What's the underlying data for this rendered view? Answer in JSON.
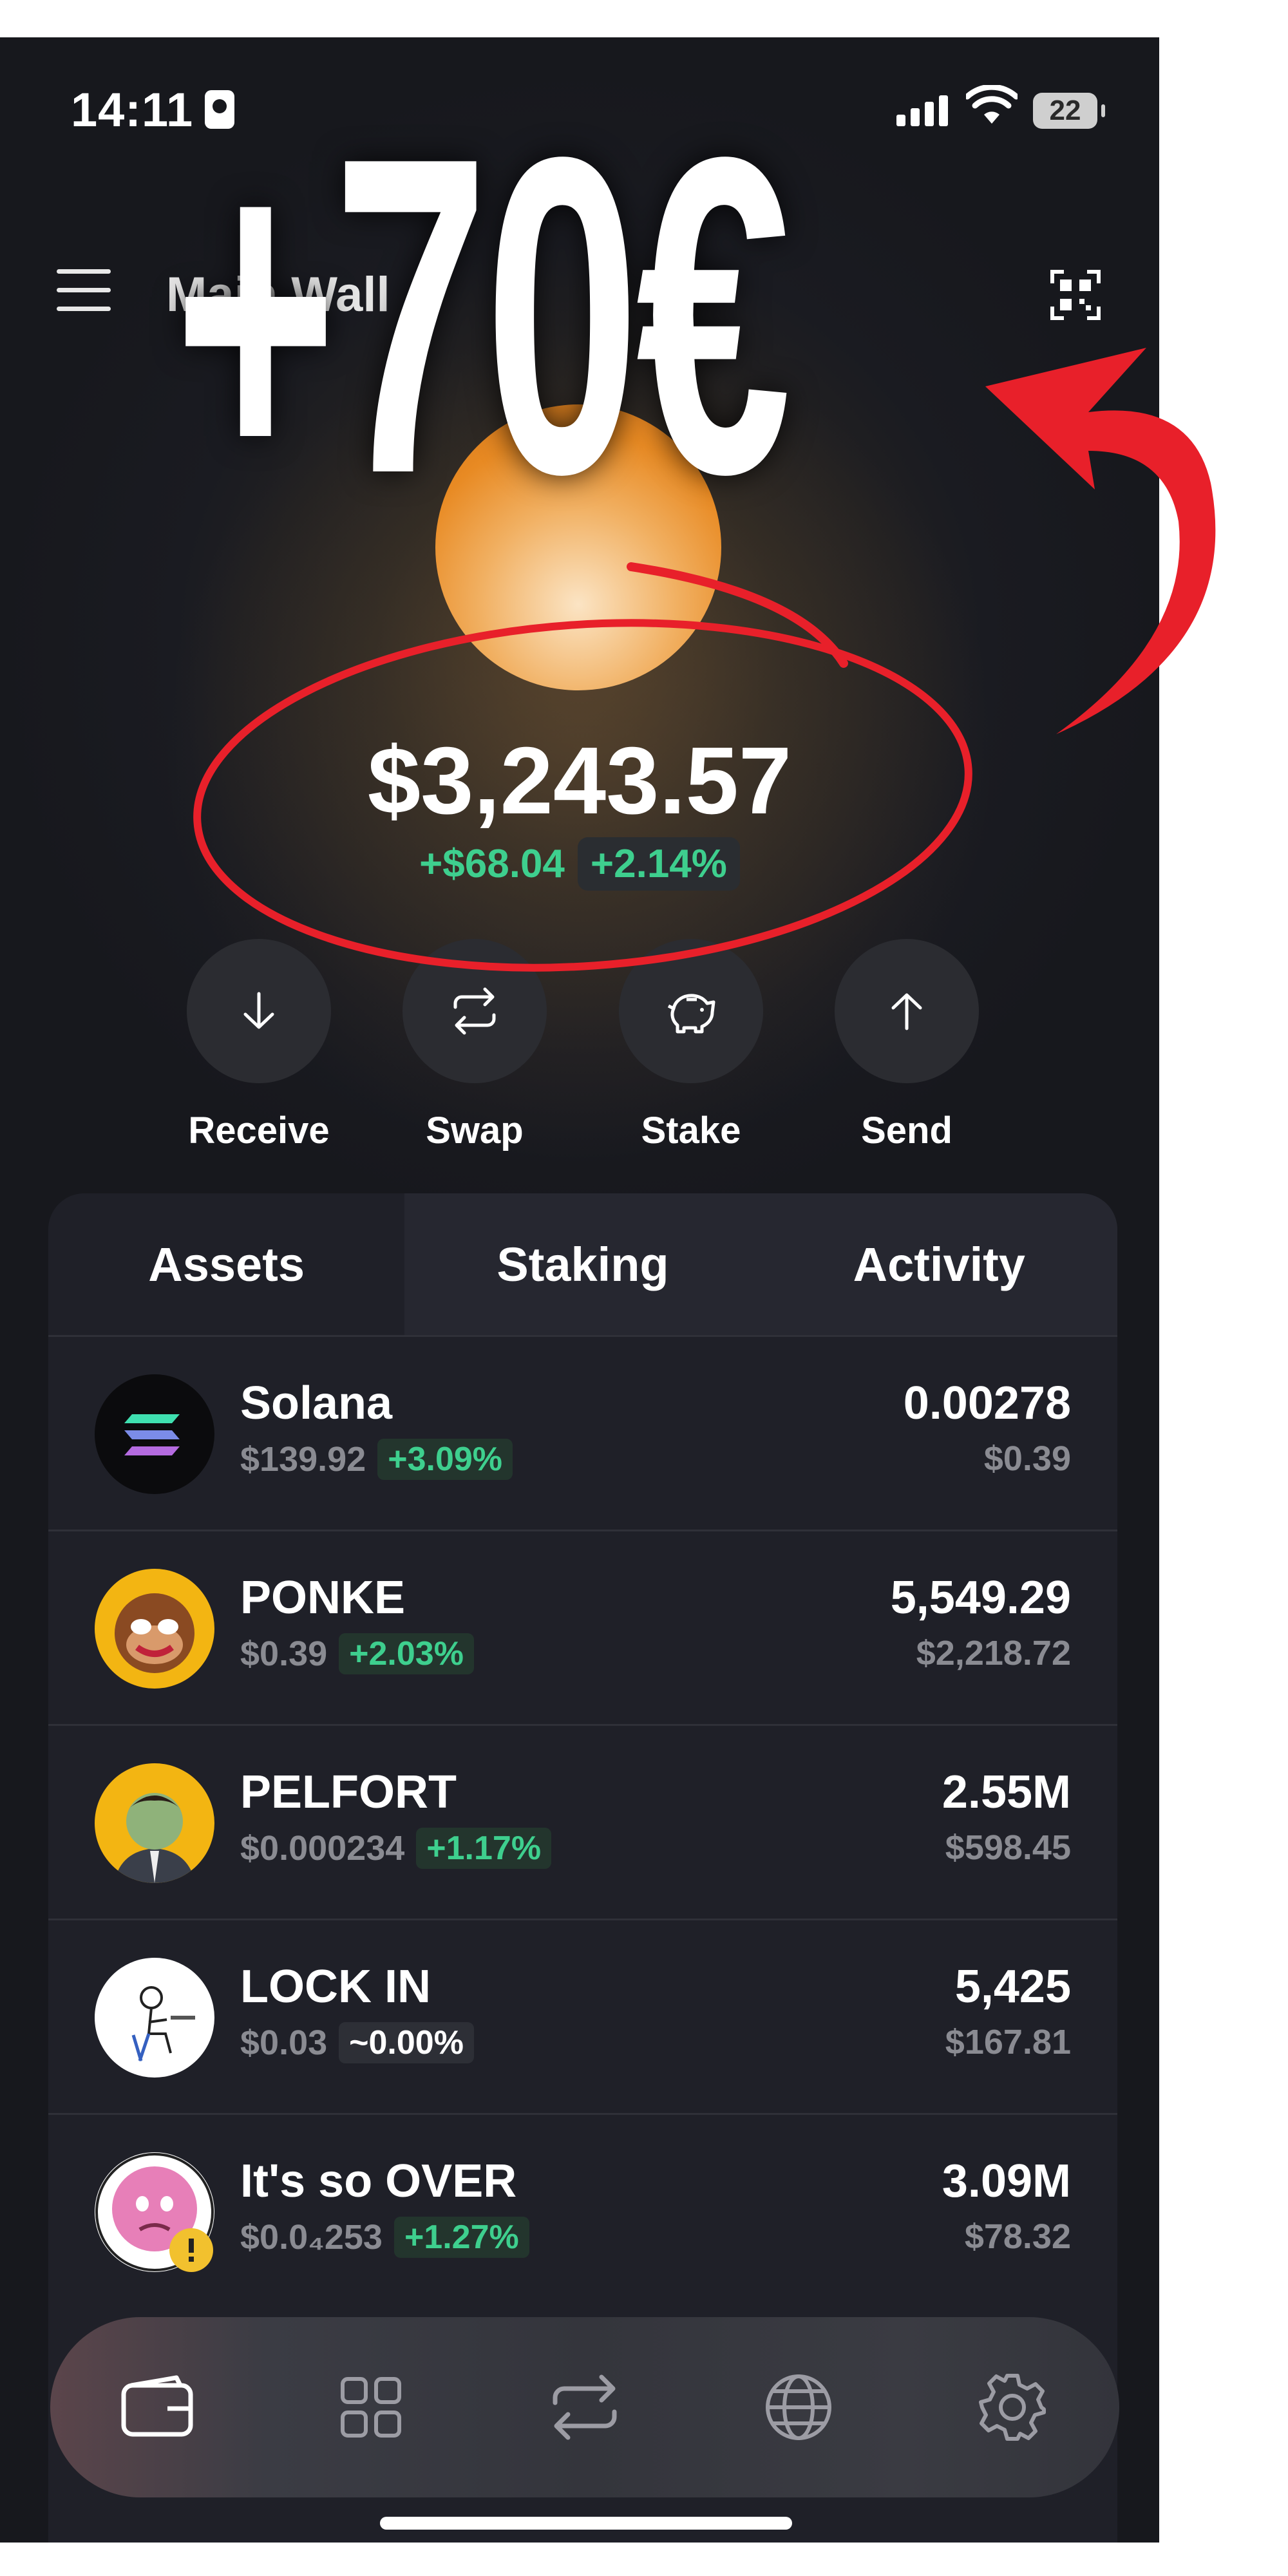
{
  "status_bar": {
    "time": "14:11",
    "battery": "22"
  },
  "header": {
    "wallet_name": "Main Wall",
    "menu_icon": "hamburger-icon",
    "qr_icon": "qr-scan-icon"
  },
  "overlay": {
    "amount_text": "+70€"
  },
  "balance": {
    "total": "$3,243.57",
    "change_abs": "+$68.04",
    "change_pct": "+2.14%"
  },
  "actions": [
    {
      "label": "Receive",
      "icon": "arrow-down-icon"
    },
    {
      "label": "Swap",
      "icon": "swap-icon"
    },
    {
      "label": "Stake",
      "icon": "piggy-bank-icon"
    },
    {
      "label": "Send",
      "icon": "arrow-up-icon"
    }
  ],
  "tabs": [
    {
      "label": "Assets"
    },
    {
      "label": "Staking"
    },
    {
      "label": "Activity"
    }
  ],
  "assets": [
    {
      "name": "Solana",
      "price": "$139.92",
      "change": "+3.09%",
      "amount": "0.00278",
      "value": "$0.39"
    },
    {
      "name": "PONKE",
      "price": "$0.39",
      "change": "+2.03%",
      "amount": "5,549.29",
      "value": "$2,218.72"
    },
    {
      "name": "PELFORT",
      "price": "$0.000234",
      "change": "+1.17%",
      "amount": "2.55M",
      "value": "$598.45"
    },
    {
      "name": "LOCK IN",
      "price": "$0.03",
      "change": "~0.00%",
      "amount": "5,425",
      "value": "$167.81"
    },
    {
      "name": "It's so OVER",
      "price": "$0.0₄253",
      "change": "+1.27%",
      "amount": "3.09M",
      "value": "$78.32"
    }
  ],
  "nav": [
    {
      "icon": "wallet-icon"
    },
    {
      "icon": "grid-icon"
    },
    {
      "icon": "swap-icon"
    },
    {
      "icon": "globe-icon"
    },
    {
      "icon": "settings-gear-icon"
    }
  ],
  "colors": {
    "positive": "#3ecf8e",
    "annotation_red": "#e8202a",
    "background": "#17181d"
  }
}
